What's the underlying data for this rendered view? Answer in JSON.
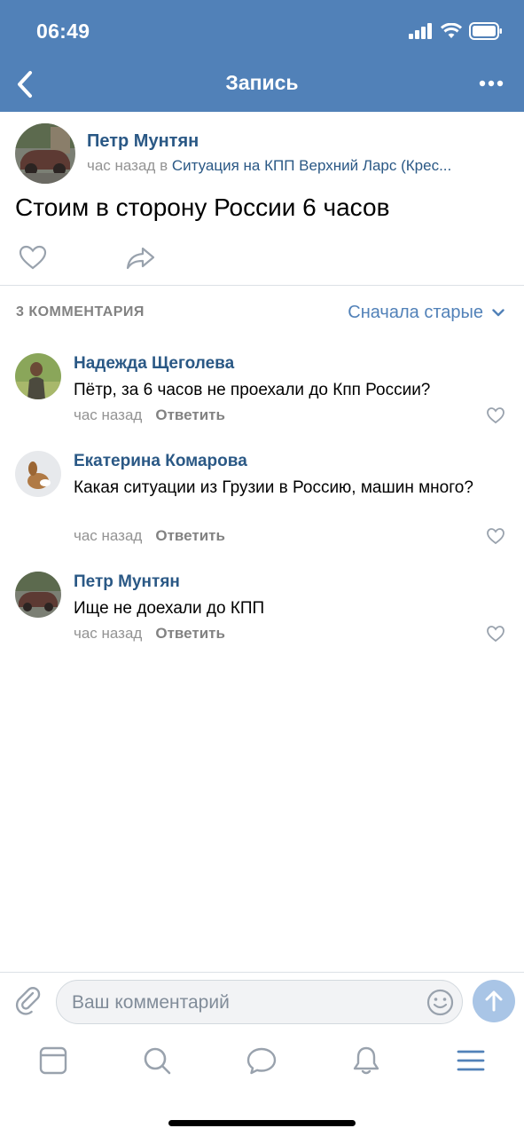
{
  "status_bar": {
    "time": "06:49"
  },
  "nav": {
    "title": "Запись"
  },
  "post": {
    "author": "Петр Мунтян",
    "time": "час назад",
    "in_word": "в",
    "group": "Ситуация на КПП Верхний Ларс (Крес...",
    "text": "Стоим в сторону России 6 часов"
  },
  "comments_header": {
    "count_label": "3 КОММЕНТАРИЯ",
    "sort_label": "Сначала старые"
  },
  "comments": [
    {
      "author": "Надежда Щеголева",
      "text": "Пётр, за 6 часов не проехали до Кпп России?",
      "time": "час назад",
      "reply": "Ответить"
    },
    {
      "author": "Екатерина Комарова",
      "text": "Какая ситуации из Грузии в Россию, машин много?",
      "time": "час назад",
      "reply": "Ответить"
    },
    {
      "author": "Петр Мунтян",
      "text": "Ище не доехали до КПП",
      "time": "час назад",
      "reply": "Ответить"
    }
  ],
  "composer": {
    "placeholder": "Ваш комментарий"
  },
  "tabbar": {
    "items": [
      "news-icon",
      "search-icon",
      "messages-icon",
      "notifications-icon",
      "menu-icon"
    ]
  },
  "colors": {
    "header": "#5181b8",
    "link": "#2a5885",
    "meta": "#939393",
    "send": "#a9c5e6"
  }
}
